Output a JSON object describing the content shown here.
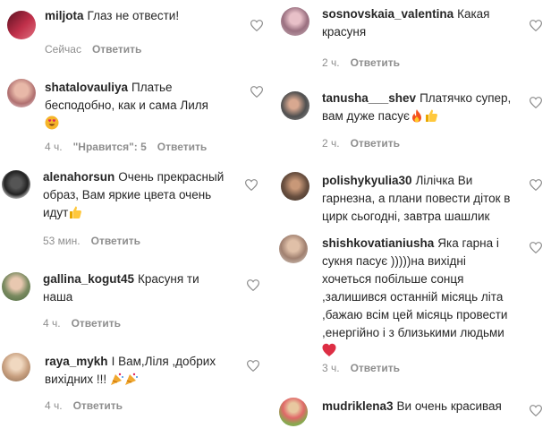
{
  "labels": {
    "reply": "Ответить"
  },
  "left": [
    {
      "user": "miljota",
      "text": "Глаз не отвести!",
      "time": "Сейчас",
      "likes": ""
    },
    {
      "user": "shatalovauliya",
      "text": "Платье бесподобно, как и сама Лиля",
      "emoji": "heart-eyes-emoji",
      "time": "4 ч.",
      "likes": "\"Нравится\": 5"
    },
    {
      "user": "alenahorsun",
      "text": "Очень прекрасный образ, Вам яркие цвета очень идут",
      "emoji": "thumbs-up-emoji",
      "time": "53 мин.",
      "likes": ""
    },
    {
      "user": "gallina_kogut45",
      "text": "Красуня ти наша",
      "time": "4 ч.",
      "likes": ""
    },
    {
      "user": "raya_mykh",
      "text": "І Вам,Ліля ,добрих вихідних !!!",
      "emoji": "party-popper-emoji",
      "time": "4 ч.",
      "likes": ""
    }
  ],
  "right": [
    {
      "user": "sosnovskaia_valentina",
      "text": "Какая красуня",
      "time": "2 ч.",
      "likes": ""
    },
    {
      "user": "tanusha___shev",
      "text": "Платячко супер, вам дуже пасує",
      "emoji": "fire-thumbs-emoji",
      "time": "2 ч.",
      "likes": ""
    },
    {
      "user": "polishykyulia30",
      "text": "Лілічка Ви гарнезна, а плани повести діток в цирк сьогодні, завтра шашлик",
      "time": "",
      "likes": ""
    },
    {
      "user": "shishkovatianiusha",
      "text": "Яка гарна і сукня пасує )))))на вихідні хочеться побільше сонця ,залишився останній місяць літа ,бажаю всім цей місяць провести ,енергійно і з близькими людьми",
      "emoji": "red-heart-emoji",
      "time": "3 ч.",
      "likes": ""
    },
    {
      "user": "mudriklena3",
      "text": "Ви очень красивая",
      "time": "",
      "likes": ""
    }
  ]
}
